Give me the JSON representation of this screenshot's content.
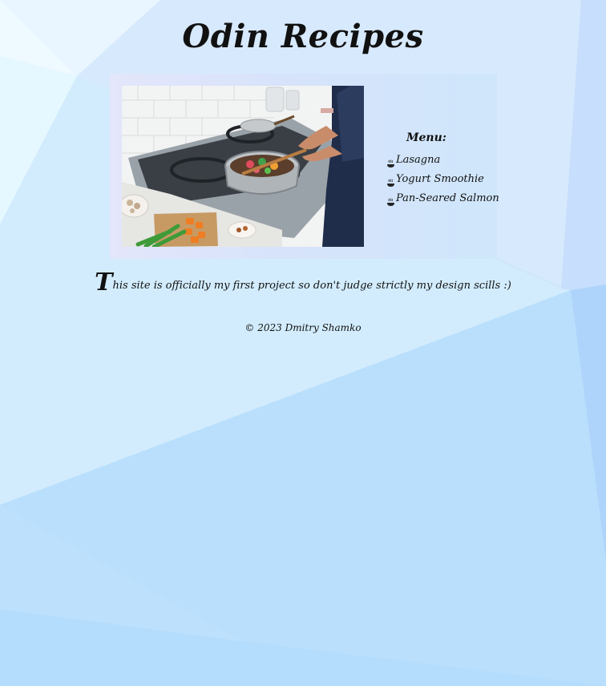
{
  "header": {
    "title": "Odin Recipes"
  },
  "hero": {
    "image_icon": "cooking-photo"
  },
  "menu": {
    "heading": "Menu:",
    "bullet_icon": "steaming-bowl-icon",
    "items": [
      {
        "label": "Lasagna"
      },
      {
        "label": "Yogurt Smoothie"
      },
      {
        "label": "Pan-Seared Salmon"
      }
    ]
  },
  "intro": {
    "dropcap": "T",
    "text": "his site is officially my first project so don't judge strictly my design scills :)"
  },
  "footer": {
    "text": "© 2023 Dmitry Shamko"
  },
  "colors": {
    "background": "#cfe6fb",
    "card": "#d9e4fb",
    "text": "#111111"
  }
}
